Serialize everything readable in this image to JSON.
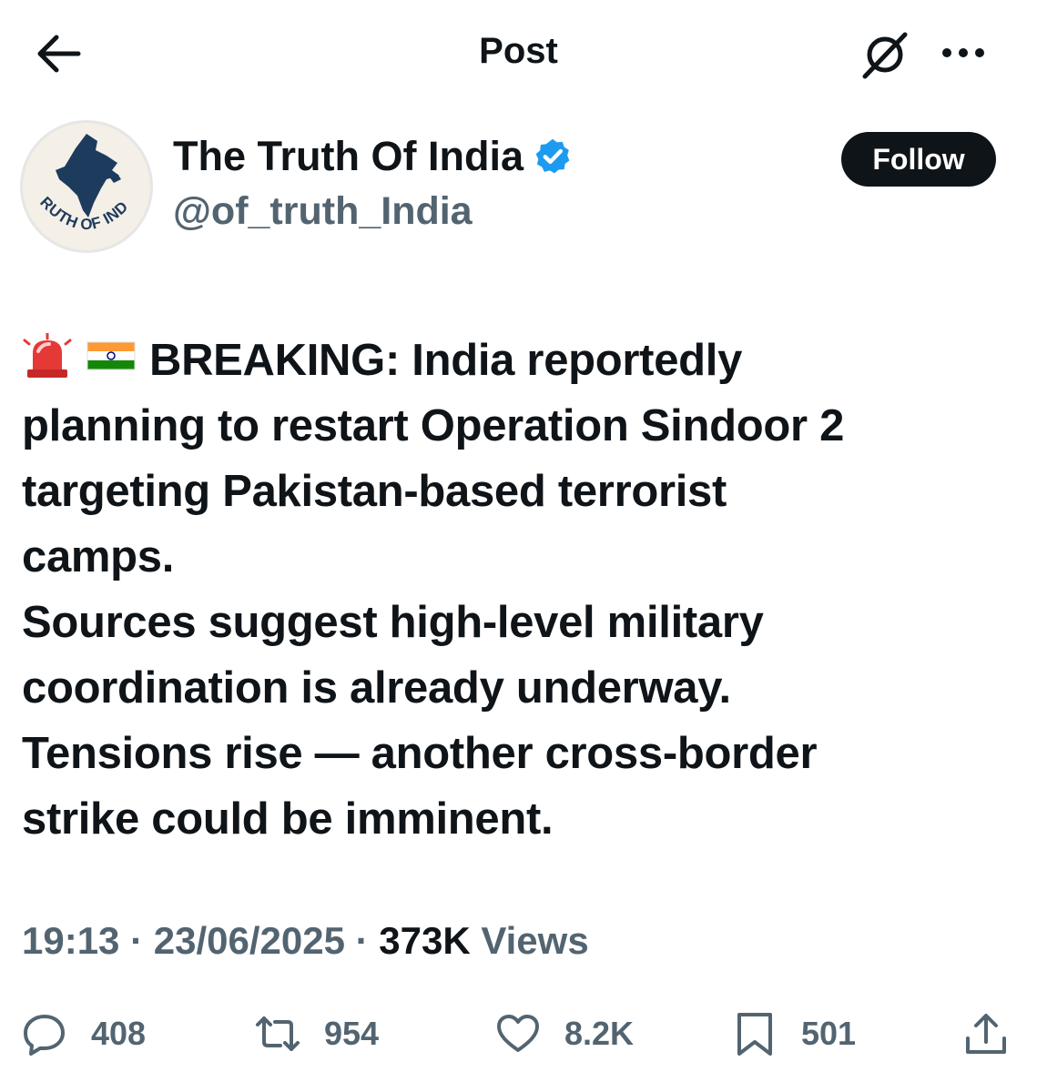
{
  "header": {
    "title": "Post"
  },
  "author": {
    "display_name": "The Truth Of India",
    "handle": "@of_truth_India",
    "avatar_text": "TRUTH OF INDIA",
    "follow_label": "Follow",
    "verified": true
  },
  "tweet": {
    "emojis": [
      "rotating-light",
      "india-flag"
    ],
    "lines": [
      "BREAKING: India reportedly",
      "planning to restart Operation Sindoor 2",
      "targeting Pakistan-based terrorist",
      "camps.",
      "Sources suggest high-level military",
      "coordination is already underway.",
      "Tensions rise — another cross-border",
      "strike could be imminent."
    ]
  },
  "meta": {
    "time": "19:13",
    "sep1": " · ",
    "date": "23/06/2025",
    "sep2": " · ",
    "views_count": "373K",
    "views_label": " Views"
  },
  "actions": {
    "replies": "408",
    "reposts": "954",
    "likes": "8.2K",
    "bookmarks": "501"
  },
  "colors": {
    "text": "#0f1419",
    "secondary": "#536471",
    "verified": "#1d9bf0",
    "follow_bg": "#0f1419"
  }
}
